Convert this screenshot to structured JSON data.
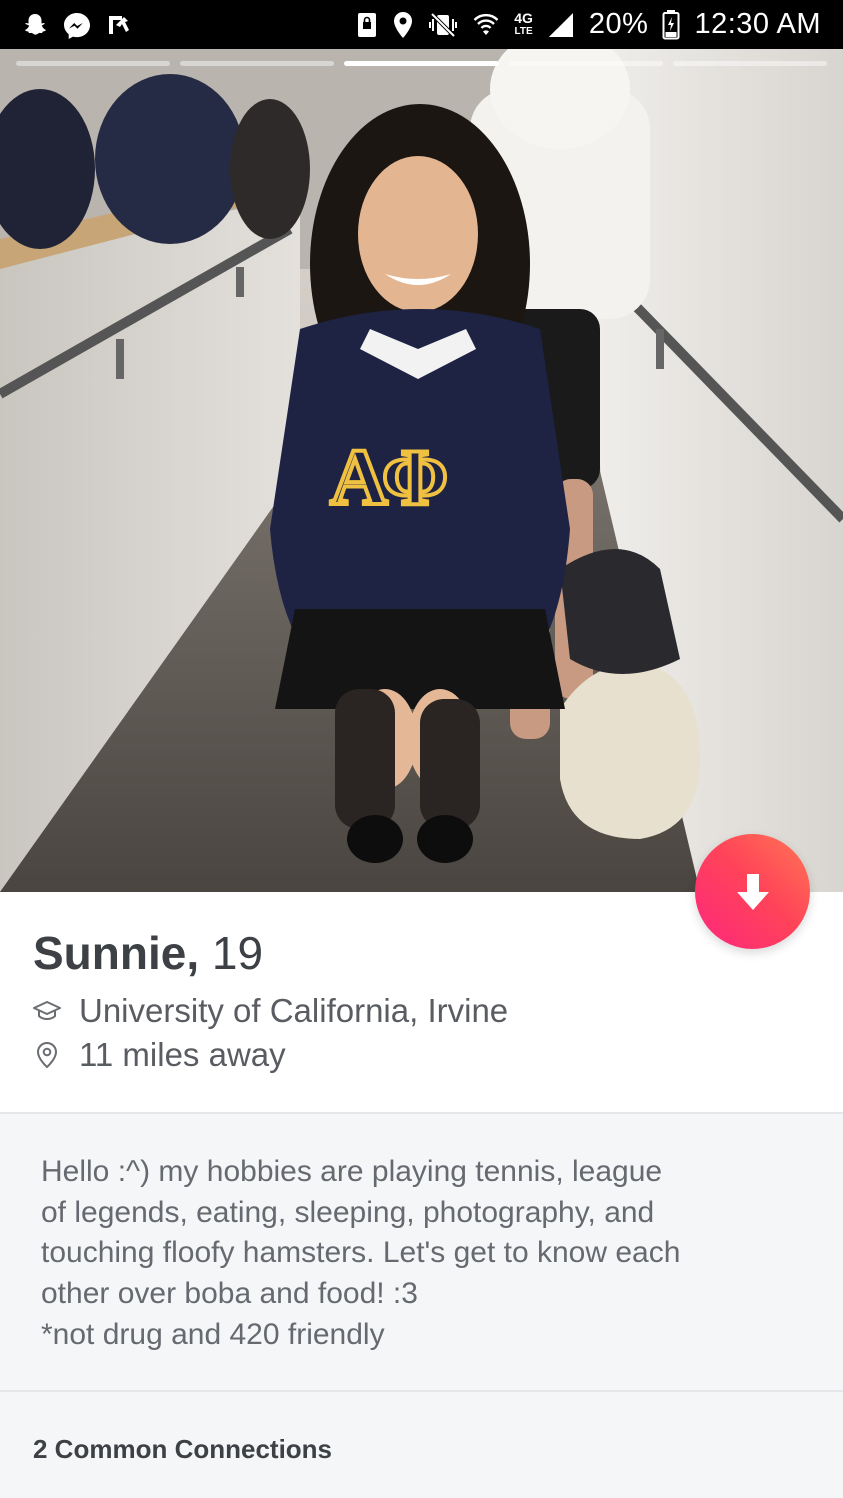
{
  "status_bar": {
    "battery": "20%",
    "time": "12:30 AM",
    "network": "4G",
    "network_sub": "LTE",
    "left_icons": [
      "snapchat-icon",
      "messenger-icon",
      "reply-arrow-icon"
    ],
    "right_icons": [
      "lock-screen-icon",
      "location-pin-icon",
      "vibrate-mute-icon",
      "wifi-icon",
      "signal-icon",
      "battery-icon"
    ]
  },
  "photo": {
    "description_icon": "profile-photo",
    "indicator_count": 5,
    "active_indicator": 2
  },
  "profile": {
    "name": "Sunnie,",
    "age": "19",
    "school": "University of California, Irvine",
    "distance": "11 miles away",
    "school_icon": "graduation-cap-icon",
    "distance_icon": "location-pin-icon"
  },
  "action_button": {
    "icon": "arrow-down-icon",
    "accent_gradient": [
      "#fd267d",
      "#ff4458",
      "#ff7854"
    ]
  },
  "bio": {
    "text": "Hello :^) my hobbies are playing tennis, league\nof legends, eating, sleeping, photography, and\ntouching floofy hamsters. Let's get to know each\nother over boba and food! :3\n*not drug and 420 friendly"
  },
  "connections": {
    "label": "2 Common Connections"
  }
}
